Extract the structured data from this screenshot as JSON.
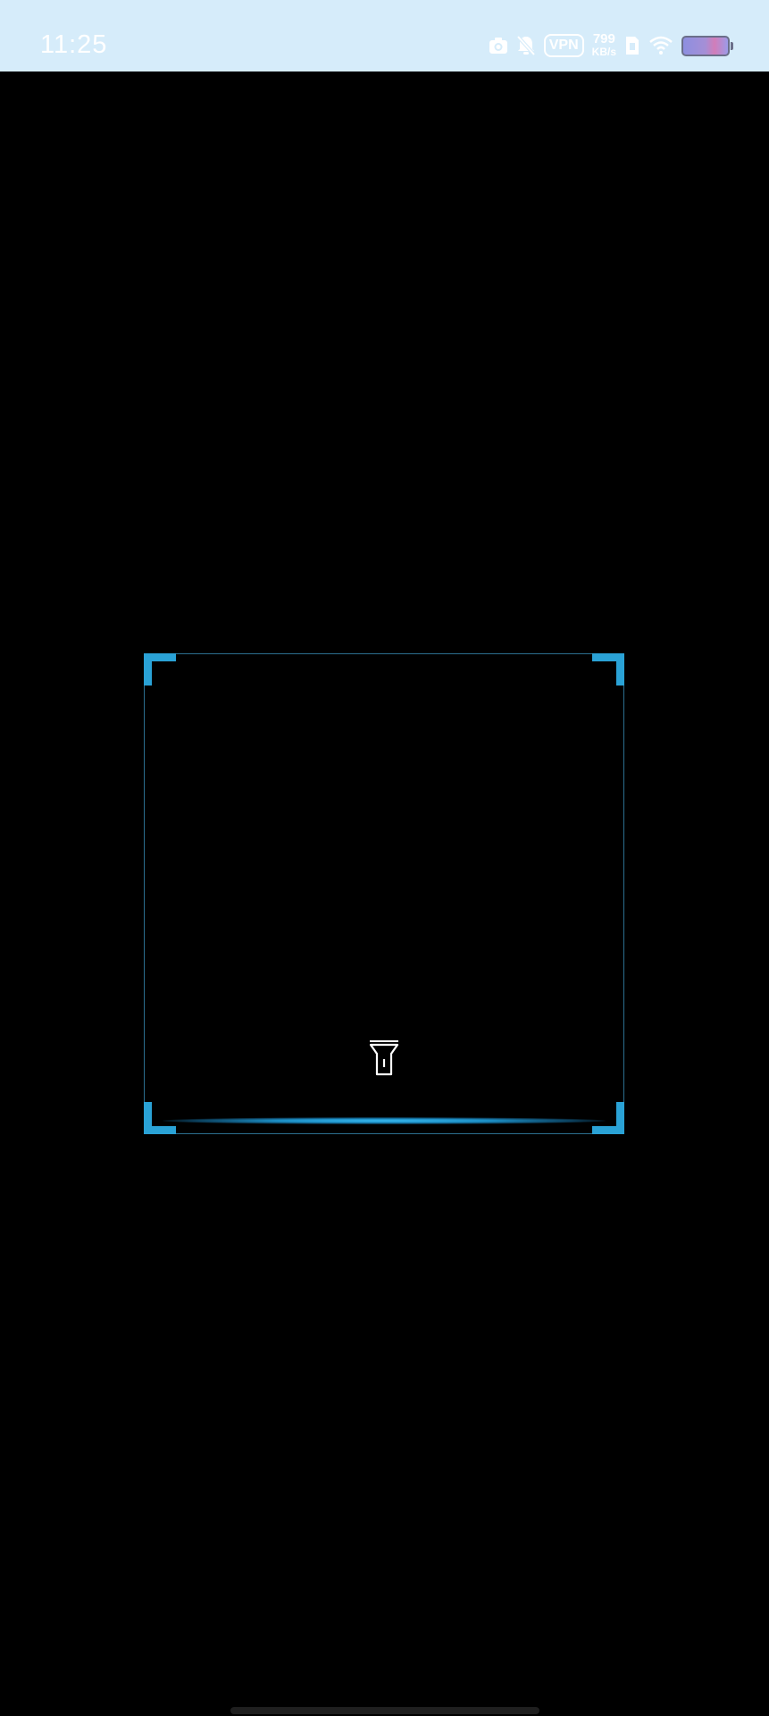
{
  "status_bar": {
    "time": "11:25",
    "vpn_label": "VPN",
    "net_speed_value": "799",
    "net_speed_unit": "KB/s",
    "icons": [
      "camera-icon",
      "silent-bell-icon",
      "vpn-icon",
      "sim-card-icon",
      "wifi-icon",
      "battery-icon"
    ]
  },
  "scanner": {
    "accent_color": "#2aa2d6",
    "flashlight_icon": "flashlight-icon"
  }
}
